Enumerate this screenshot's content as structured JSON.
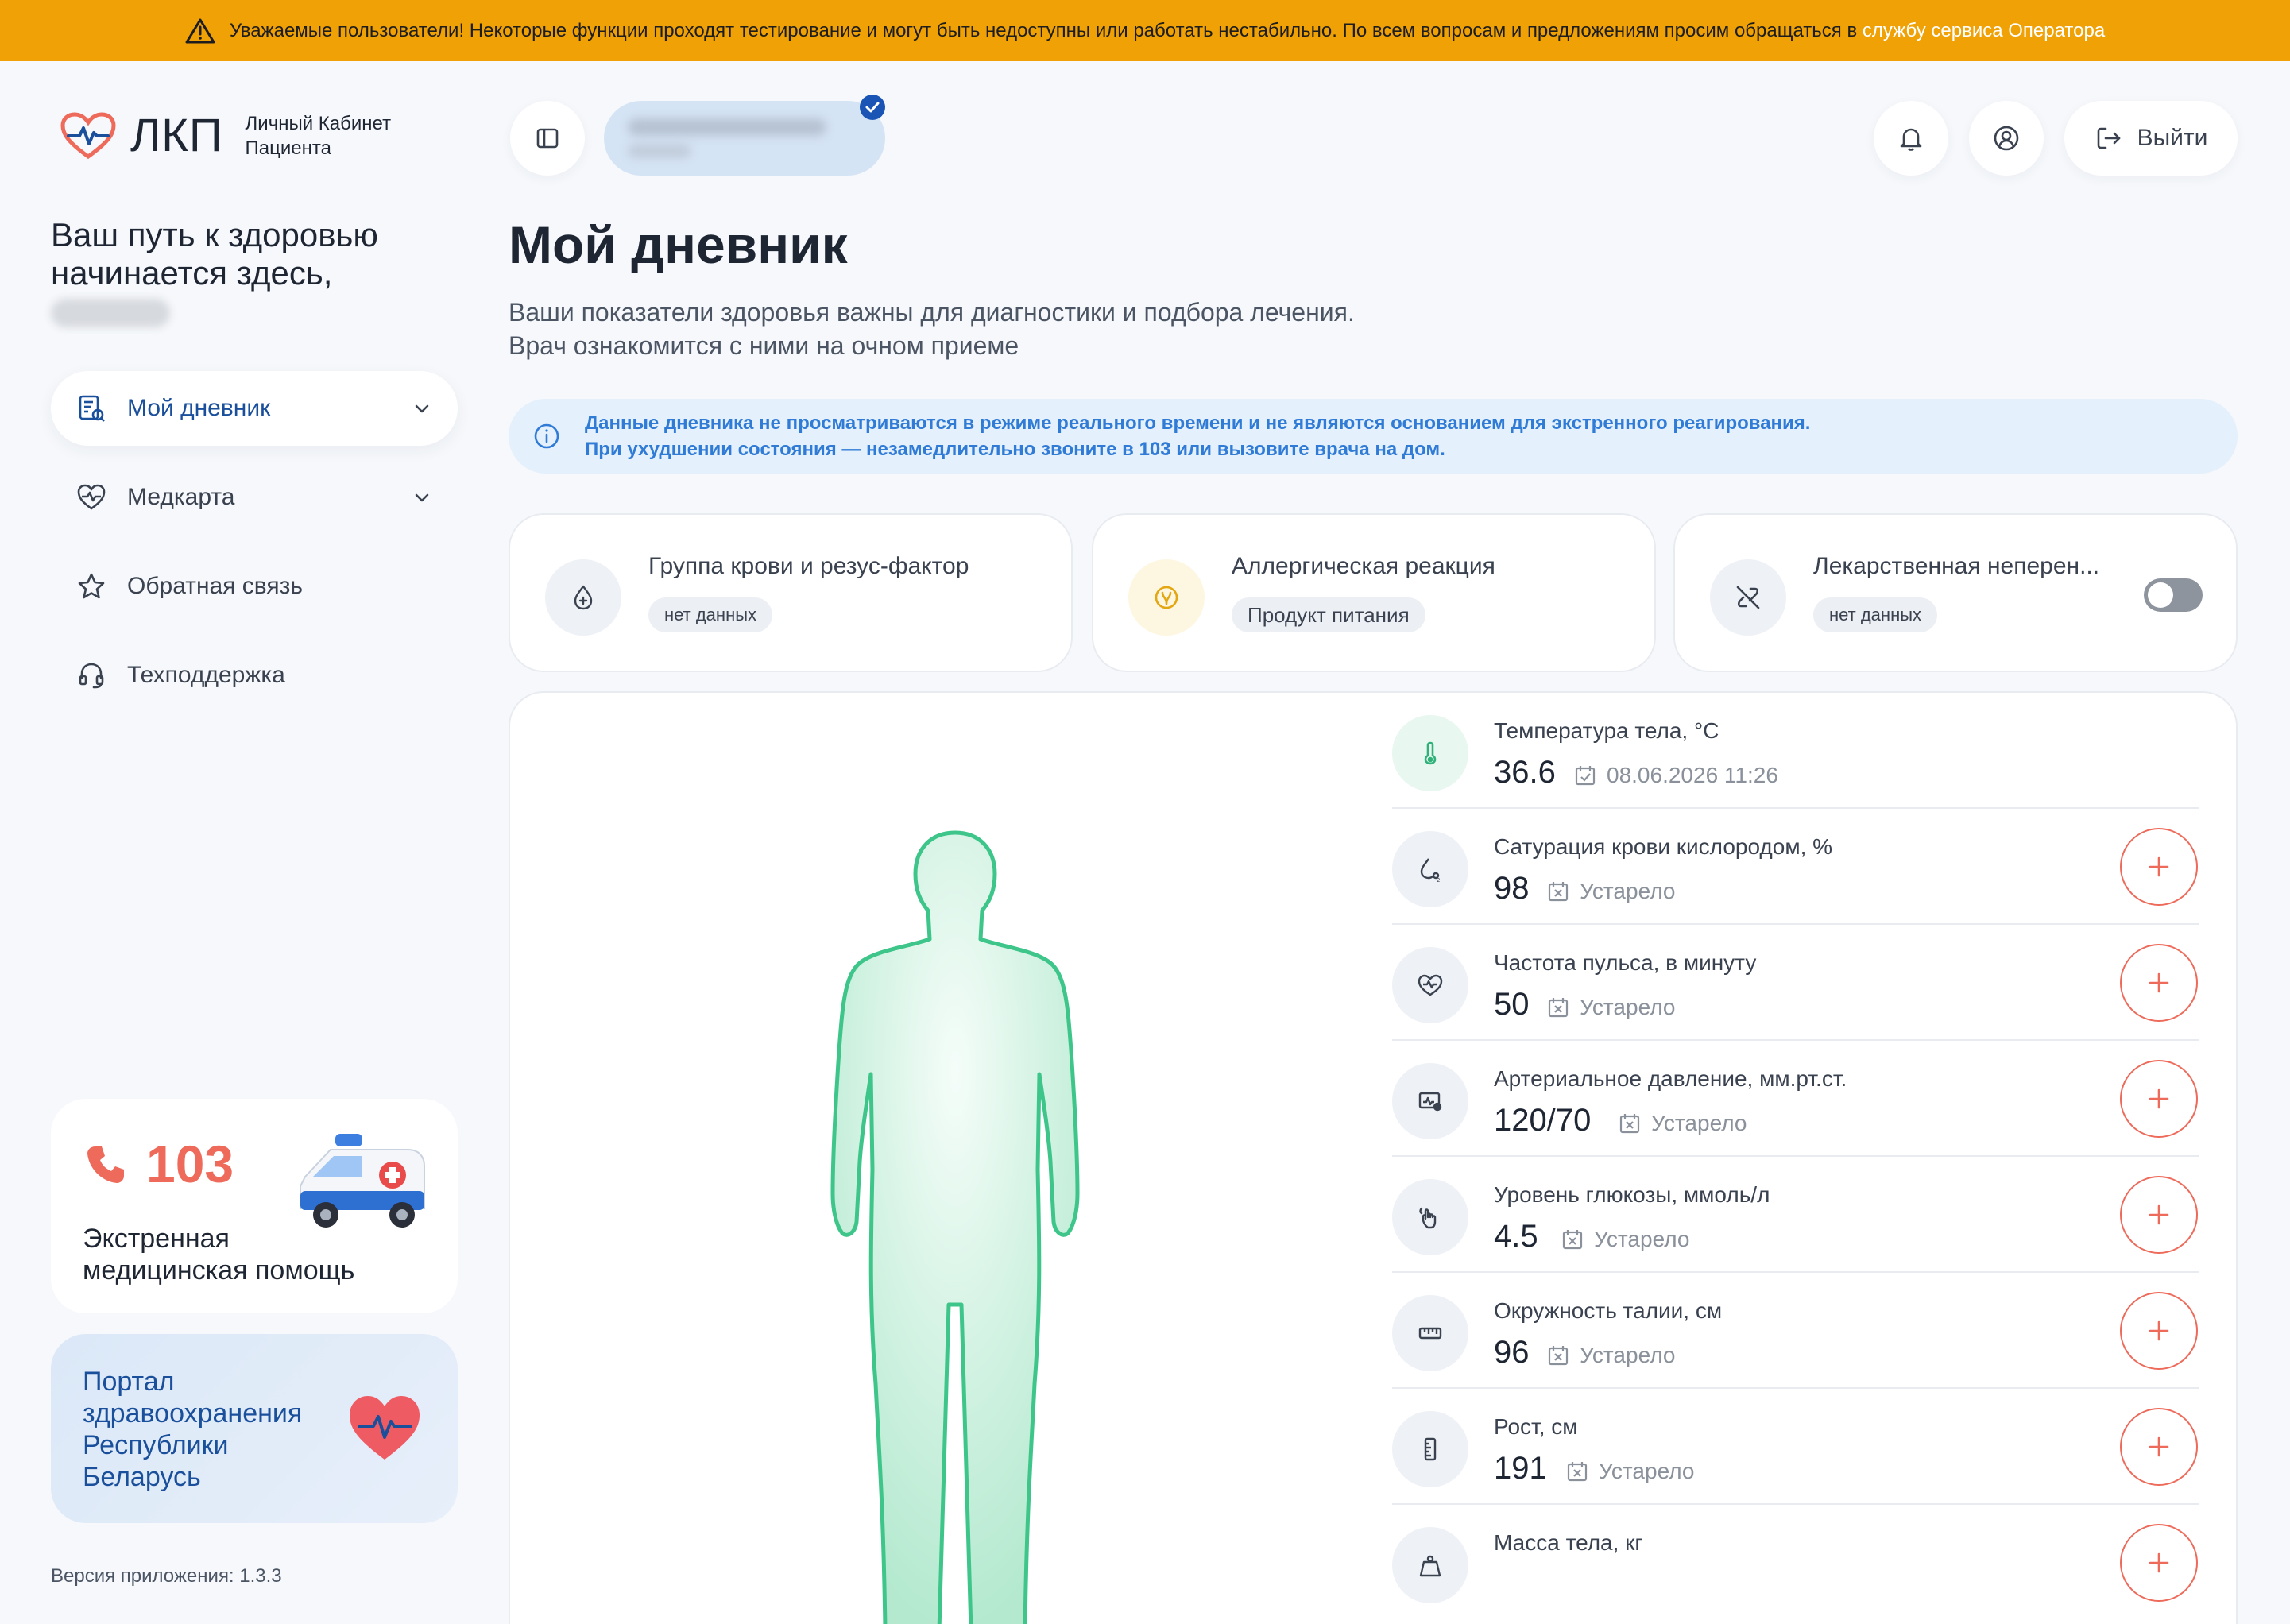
{
  "banner": {
    "text": "Уважаемые пользователи! Некоторые функции проходят тестирование и могут быть недоступны или работать нестабильно. По всем вопросам и предложениям просим обращаться в",
    "link": "службу сервиса Оператора"
  },
  "logo": {
    "abbr": "ЛКП",
    "line1": "Личный Кабинет",
    "line2": "Пациента"
  },
  "welcome": "Ваш путь к здоровью начинается здесь,",
  "nav": [
    {
      "label": "Мой дневник",
      "icon": "diary-icon",
      "active": true,
      "chevron": true
    },
    {
      "label": "Медкарта",
      "icon": "heart-pulse-icon",
      "active": false,
      "chevron": true
    },
    {
      "label": "Обратная связь",
      "icon": "star-icon",
      "active": false,
      "chevron": false
    },
    {
      "label": "Техподдержка",
      "icon": "headset-icon",
      "active": false,
      "chevron": false
    }
  ],
  "emergency": {
    "number": "103",
    "line1": "Экстренная",
    "line2": "медицинская помощь"
  },
  "portal": {
    "line1": "Портал",
    "line2": "здравоохранения",
    "line3": "Республики",
    "line4": "Беларусь"
  },
  "version": "Версия приложения: 1.3.3",
  "header": {
    "logout": "Выйти"
  },
  "page": {
    "title": "Мой дневник",
    "subtitle1": "Ваши показатели здоровья важны для диагностики и подбора лечения.",
    "subtitle2": "Врач ознакомится с ними на очном приеме"
  },
  "info": {
    "line1": "Данные дневника не просматриваются в режиме реального времени и не являются основанием для экстренного реагирования.",
    "line2": "При ухудшении состояния — незамедлительно звоните в 103 или вызовите врача на дом."
  },
  "cards": [
    {
      "title": "Группа крови и резус-фактор",
      "tag": "нет данных",
      "icon": "blood-drop-icon"
    },
    {
      "title": "Аллергическая реакция",
      "tag": "Продукт питания",
      "icon": "allergy-icon"
    },
    {
      "title": "Лекарственная неперен...",
      "tag": "нет данных",
      "icon": "pill-off-icon",
      "toggle": false
    }
  ],
  "metrics": [
    {
      "name": "Температура тела, °C",
      "value": "36.6",
      "date": "08.06.2026 11:26",
      "icon": "thermometer-icon",
      "fresh": true
    },
    {
      "name": "Сатурация крови кислородом, %",
      "value": "98",
      "date": "Устарело",
      "icon": "oxygen-drop-icon",
      "fresh": false
    },
    {
      "name": "Частота пульса, в минуту",
      "value": "50",
      "date": "Устарело",
      "icon": "pulse-heart-icon",
      "fresh": false
    },
    {
      "name": "Артериальное давление, мм.рт.ст.",
      "value": "120/70",
      "date": "Устарело",
      "icon": "pressure-icon",
      "fresh": false
    },
    {
      "name": "Уровень глюкозы, ммоль/л",
      "value": "4.5",
      "date": "Устарело",
      "icon": "glucose-icon",
      "fresh": false
    },
    {
      "name": "Окружность талии, см",
      "value": "96",
      "date": "Устарело",
      "icon": "tape-measure-icon",
      "fresh": false
    },
    {
      "name": "Рост, см",
      "value": "191",
      "date": "Устарело",
      "icon": "ruler-icon",
      "fresh": false
    },
    {
      "name": "Масса тела, кг",
      "value": "",
      "date": "",
      "icon": "weight-icon",
      "fresh": false
    }
  ],
  "colors": {
    "accent": "#1a4f9c",
    "warning": "#f0a106",
    "danger": "#ee6a5a",
    "body": "#4cc791"
  }
}
